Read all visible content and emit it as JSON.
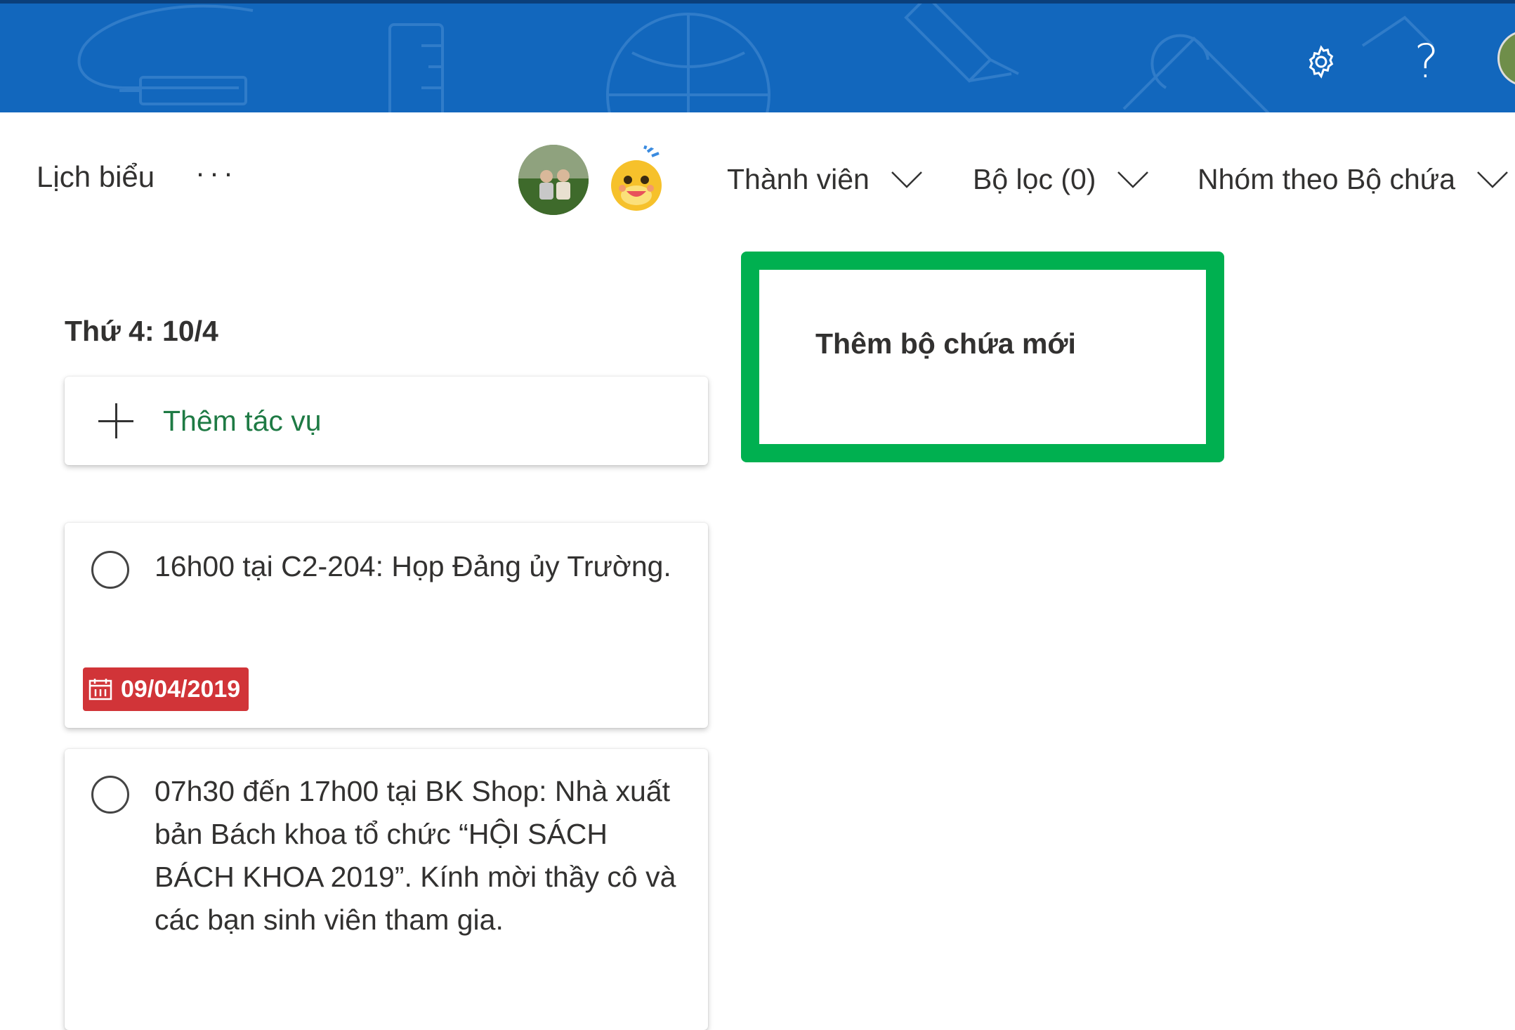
{
  "header": {
    "settings_icon": "gear-icon",
    "help_icon": "help-icon",
    "help_label": "?"
  },
  "plan": {
    "title": "Lịch biểu",
    "more_label": "···"
  },
  "toolbar": {
    "members_label": "Thành viên",
    "filter_label": "Bộ lọc (0)",
    "group_label": "Nhóm theo Bộ chứa"
  },
  "bucket": {
    "title": "Thứ 4: 10/4",
    "add_task_label": "Thêm tác vụ",
    "tasks": [
      {
        "text": "16h00 tại C2-204: Họp Đảng ủy Trường.",
        "due_date": "09/04/2019"
      },
      {
        "text": "07h30 đến 17h00 tại BK Shop: Nhà xuất bản Bách khoa tổ chức “HỘI SÁCH BÁCH KHOA 2019”. Kính mời thầy cô và các bạn sinh viên tham gia."
      }
    ]
  },
  "new_bucket": {
    "label": "Thêm bộ chứa mới"
  },
  "colors": {
    "header_bg": "#1267bd",
    "highlight_border": "#00b050",
    "due_badge": "#d13438",
    "add_task_text": "#1e7a44"
  }
}
